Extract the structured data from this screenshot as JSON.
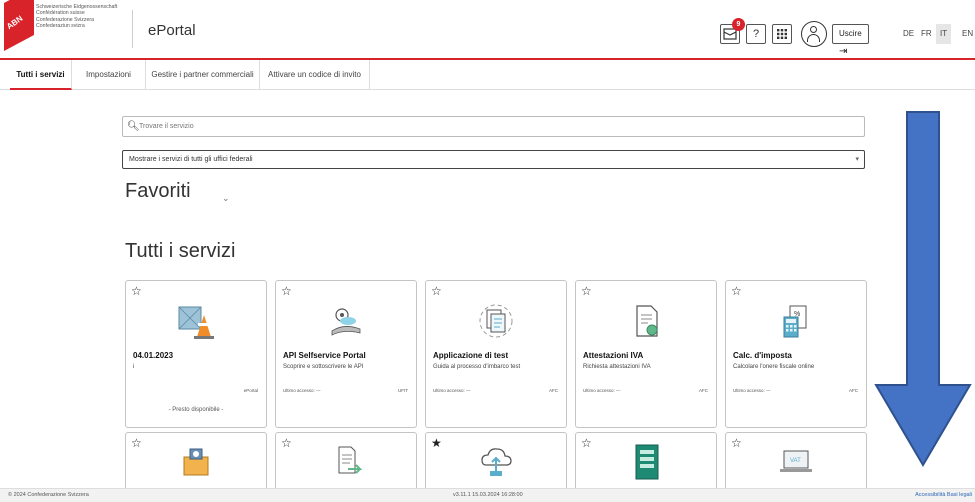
{
  "header": {
    "logo_badge": "ABN",
    "confederation_lines": [
      "Schweizerische Eidgenossenschaft",
      "Confédération suisse",
      "Confederazione Svizzera",
      "Confederaziun svizra"
    ],
    "app_title": "ePortal",
    "notification_count": "9",
    "help_label": "?",
    "exit_label": "Uscire",
    "languages": [
      "DE",
      "FR",
      "IT",
      "EN"
    ],
    "active_language": "IT"
  },
  "tabs": [
    {
      "label": "Tutti i servizi",
      "active": true
    },
    {
      "label": "Impostazioni",
      "active": false
    },
    {
      "label": "Gestire i partner commerciali",
      "active": false
    },
    {
      "label": "Attivare un codice di invito",
      "active": false
    }
  ],
  "search": {
    "placeholder": "Trovare il servizio"
  },
  "office_select": {
    "value": "Mostrare i servizi di tutti gli uffici federali"
  },
  "favorites_heading": "Favoriti",
  "all_services_heading": "Tutti i servizi",
  "cards_row1": [
    {
      "title": "04.01.2023",
      "desc": "i",
      "last_access": "",
      "org": "ePortal",
      "soon": "- Presto disponibile -",
      "icon": "construction-cone-icon",
      "starred": false
    },
    {
      "title": "API Selfservice Portal",
      "desc": "Scoprire e sottoscrivere le API",
      "last_access": "Ultimo accesso: —",
      "org": "UFIT",
      "soon": "",
      "icon": "api-hand-icon",
      "starred": false
    },
    {
      "title": "Applicazione di test",
      "desc": "Guida al processo d'imbarco test",
      "last_access": "Ultimo accesso: —",
      "org": "AFC",
      "soon": "",
      "icon": "test-documents-icon",
      "starred": false
    },
    {
      "title": "Attestazioni IVA",
      "desc": "Richiesta attestazioni IVA",
      "last_access": "Ultimo accesso: —",
      "org": "AFC",
      "soon": "",
      "icon": "certificate-document-icon",
      "starred": false
    },
    {
      "title": "Calc. d'imposta",
      "desc": "Calcolare l'onere fiscale online",
      "last_access": "Ultimo accesso: —",
      "org": "AFC",
      "soon": "",
      "icon": "tax-calculator-icon",
      "starred": false
    }
  ],
  "cards_row2": [
    {
      "icon": "camera-folder-icon",
      "starred": false
    },
    {
      "icon": "document-transfer-icon",
      "starred": false
    },
    {
      "icon": "cloud-upload-icon",
      "starred": true
    },
    {
      "icon": "green-form-icon",
      "starred": false
    },
    {
      "icon": "vat-laptop-icon",
      "starred": false,
      "icon_text": "VAT"
    }
  ],
  "footer": {
    "copyright": "© 2024 Confederazione Svizzera",
    "version": "v3.11.1 15.03.2024 16:28:00",
    "links": "Accessibilità  Basi legali"
  },
  "colors": {
    "brand_red": "#d8232a",
    "arrow_blue": "#4472c4",
    "arrow_border": "#2f528f"
  }
}
